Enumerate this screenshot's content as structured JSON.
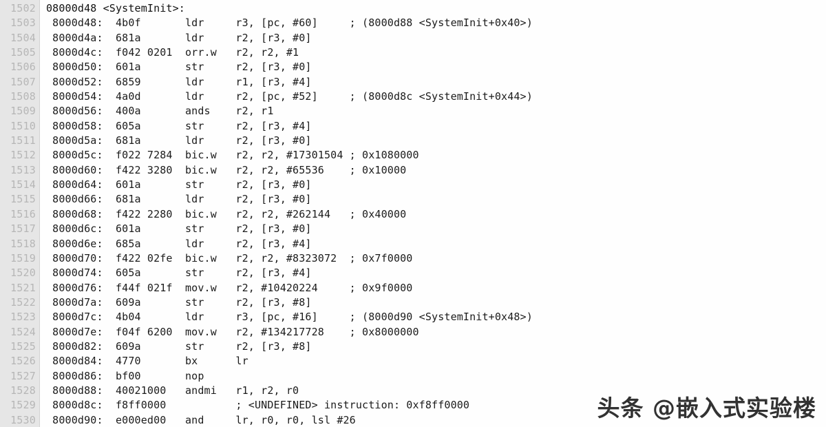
{
  "editor": {
    "title": "disassembly-listing",
    "gutter": {
      "line_numbers": [
        "1502",
        "1503",
        "1504",
        "1505",
        "1506",
        "1507",
        "1508",
        "1509",
        "1510",
        "1511",
        "1512",
        "1513",
        "1514",
        "1515",
        "1516",
        "1517",
        "1518",
        "1519",
        "1520",
        "1521",
        "1522",
        "1523",
        "1524",
        "1525",
        "1526",
        "1527",
        "1528",
        "1529",
        "1530"
      ]
    },
    "lines": [
      {
        "num": "1502",
        "text": "08000d48 <SystemInit>:",
        "kind": "label"
      },
      {
        "num": "1503",
        "text": " 8000d48:\t4b0f      \tldr\tr3, [pc, #60]\t; (8000d88 <SystemInit+0x40>)",
        "kind": "insn"
      },
      {
        "num": "1504",
        "text": " 8000d4a:\t681a      \tldr\tr2, [r3, #0]",
        "kind": "insn"
      },
      {
        "num": "1505",
        "text": " 8000d4c:\tf042 0201 \torr.w\tr2, r2, #1",
        "kind": "insn"
      },
      {
        "num": "1506",
        "text": " 8000d50:\t601a      \tstr\tr2, [r3, #0]",
        "kind": "insn"
      },
      {
        "num": "1507",
        "text": " 8000d52:\t6859      \tldr\tr1, [r3, #4]",
        "kind": "insn"
      },
      {
        "num": "1508",
        "text": " 8000d54:\t4a0d      \tldr\tr2, [pc, #52]\t; (8000d8c <SystemInit+0x44>)",
        "kind": "insn"
      },
      {
        "num": "1509",
        "text": " 8000d56:\t400a      \tands\tr2, r1",
        "kind": "insn"
      },
      {
        "num": "1510",
        "text": " 8000d58:\t605a      \tstr\tr2, [r3, #4]",
        "kind": "insn"
      },
      {
        "num": "1511",
        "text": " 8000d5a:\t681a      \tldr\tr2, [r3, #0]",
        "kind": "insn"
      },
      {
        "num": "1512",
        "text": " 8000d5c:\tf022 7284 \tbic.w\tr2, r2, #17301504\t; 0x1080000",
        "kind": "insn"
      },
      {
        "num": "1513",
        "text": " 8000d60:\tf422 3280 \tbic.w\tr2, r2, #65536\t; 0x10000",
        "kind": "insn"
      },
      {
        "num": "1514",
        "text": " 8000d64:\t601a      \tstr\tr2, [r3, #0]",
        "kind": "insn"
      },
      {
        "num": "1515",
        "text": " 8000d66:\t681a      \tldr\tr2, [r3, #0]",
        "kind": "insn"
      },
      {
        "num": "1516",
        "text": " 8000d68:\tf422 2280 \tbic.w\tr2, r2, #262144\t; 0x40000",
        "kind": "insn"
      },
      {
        "num": "1517",
        "text": " 8000d6c:\t601a      \tstr\tr2, [r3, #0]",
        "kind": "insn"
      },
      {
        "num": "1518",
        "text": " 8000d6e:\t685a      \tldr\tr2, [r3, #4]",
        "kind": "insn"
      },
      {
        "num": "1519",
        "text": " 8000d70:\tf422 02fe \tbic.w\tr2, r2, #8323072\t; 0x7f0000",
        "kind": "insn"
      },
      {
        "num": "1520",
        "text": " 8000d74:\t605a      \tstr\tr2, [r3, #4]",
        "kind": "insn"
      },
      {
        "num": "1521",
        "text": " 8000d76:\tf44f 021f \tmov.w\tr2, #10420224\t; 0x9f0000",
        "kind": "insn"
      },
      {
        "num": "1522",
        "text": " 8000d7a:\t609a      \tstr\tr2, [r3, #8]",
        "kind": "insn"
      },
      {
        "num": "1523",
        "text": " 8000d7c:\t4b04      \tldr\tr3, [pc, #16]\t; (8000d90 <SystemInit+0x48>)",
        "kind": "insn"
      },
      {
        "num": "1524",
        "text": " 8000d7e:\tf04f 6200 \tmov.w\tr2, #134217728\t; 0x8000000",
        "kind": "insn"
      },
      {
        "num": "1525",
        "text": " 8000d82:\t609a      \tstr\tr2, [r3, #8]",
        "kind": "insn"
      },
      {
        "num": "1526",
        "text": " 8000d84:\t4770      \tbx\tlr",
        "kind": "insn"
      },
      {
        "num": "1527",
        "text": " 8000d86:\tbf00      \tnop",
        "kind": "insn"
      },
      {
        "num": "1528",
        "text": " 8000d88:\t40021000 \tandmi\tr1, r2, r0",
        "kind": "insn"
      },
      {
        "num": "1529",
        "text": " 8000d8c:\tf8ff0000 \t\t; <UNDEFINED> instruction: 0xf8ff0000",
        "kind": "insn"
      },
      {
        "num": "1530",
        "text": " 8000d90:\te000ed00 \tand\tlr, r0, r0, lsl #26",
        "kind": "insn"
      }
    ]
  },
  "watermark": {
    "text": "头条 @嵌入式实验楼"
  },
  "colors": {
    "gutter_bg": "#e6e6e6",
    "gutter_text": "#b6b6b6",
    "code_bg": "#fefefe",
    "code_text": "#1b1b1b"
  }
}
